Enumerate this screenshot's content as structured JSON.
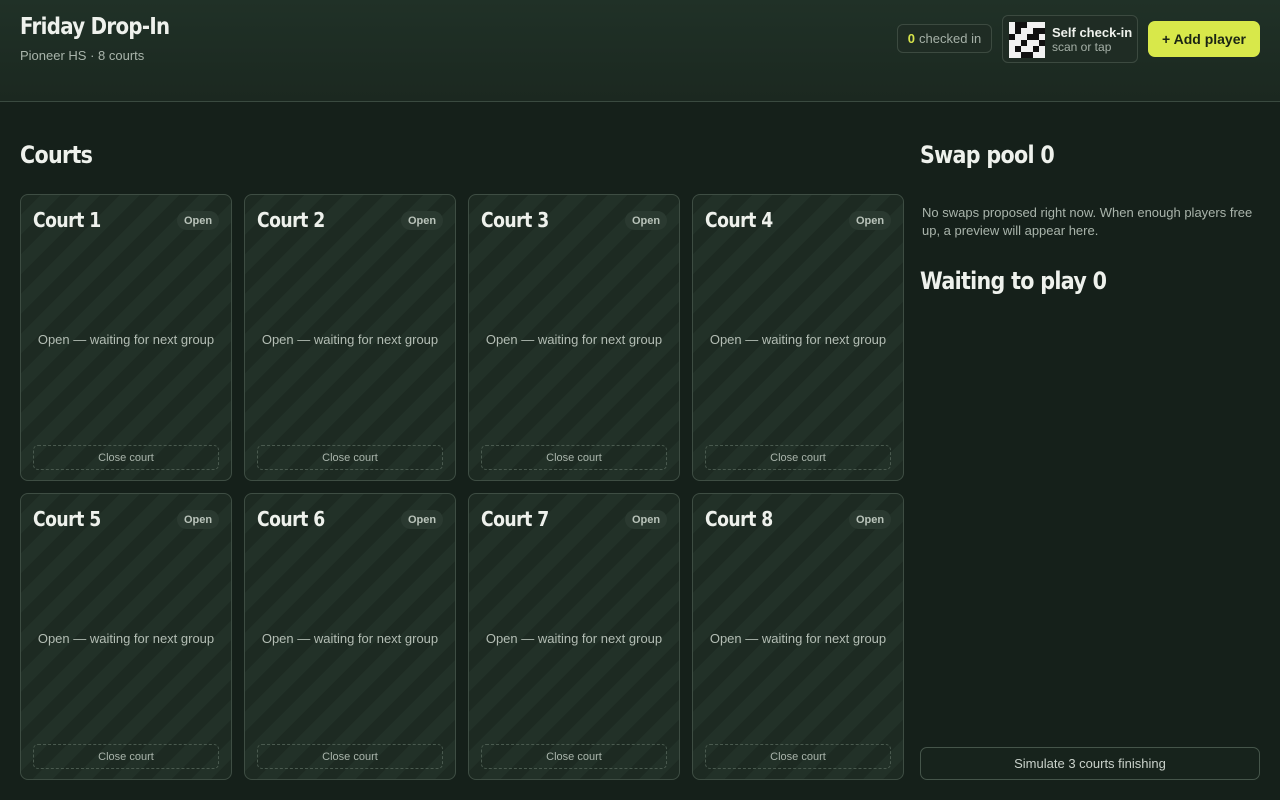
{
  "header": {
    "title": "Friday Drop-In",
    "subtitle": "Pioneer HS · 8 courts",
    "checked_in": {
      "count": "0",
      "label": "checked in"
    },
    "self_checkin": {
      "title": "Self check-in",
      "subtitle": "scan or tap",
      "icon": "qr-code-icon"
    },
    "add_player_label": "+ Add player",
    "accent_color": "#d8e84a"
  },
  "courts_section": {
    "title": "Courts",
    "courts": [
      {
        "name": "Court 1",
        "status": "Open",
        "message": "Open — waiting for next group",
        "action": "Close court"
      },
      {
        "name": "Court 2",
        "status": "Open",
        "message": "Open — waiting for next group",
        "action": "Close court"
      },
      {
        "name": "Court 3",
        "status": "Open",
        "message": "Open — waiting for next group",
        "action": "Close court"
      },
      {
        "name": "Court 4",
        "status": "Open",
        "message": "Open — waiting for next group",
        "action": "Close court"
      },
      {
        "name": "Court 5",
        "status": "Open",
        "message": "Open — waiting for next group",
        "action": "Close court"
      },
      {
        "name": "Court 6",
        "status": "Open",
        "message": "Open — waiting for next group",
        "action": "Close court"
      },
      {
        "name": "Court 7",
        "status": "Open",
        "message": "Open — waiting for next group",
        "action": "Close court"
      },
      {
        "name": "Court 8",
        "status": "Open",
        "message": "Open — waiting for next group",
        "action": "Close court"
      }
    ]
  },
  "sidebar": {
    "swap_pool_title": "Swap pool 0",
    "swap_pool_empty": "No swaps proposed right now. When enough players free up, a preview will appear here.",
    "waiting_title": "Waiting to play 0",
    "simulate_label": "Simulate 3 courts finishing"
  }
}
